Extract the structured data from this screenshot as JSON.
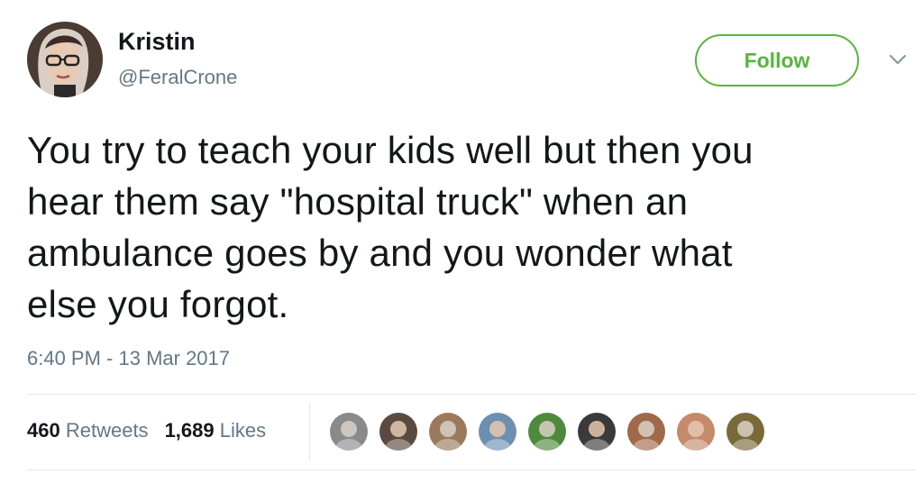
{
  "author": {
    "display_name": "Kristin",
    "handle": "@FeralCrone",
    "avatar_icon": "profile-photo-woman-glasses"
  },
  "follow_button": {
    "label": "Follow",
    "color": "#57b53c"
  },
  "menu_icon": "chevron-down-icon",
  "tweet": {
    "lines": [
      "You try to teach your kids well but then you",
      "hear them say \"hospital truck\" when an",
      "ambulance goes by and you wonder what",
      "else you forgot."
    ],
    "timestamp": "6:40 PM - 13 Mar 2017"
  },
  "stats": {
    "retweets_count": "460",
    "retweets_label": "Retweets",
    "likes_count": "1,689",
    "likes_label": "Likes"
  },
  "liked_by": [
    {
      "icon": "liker-avatar-1",
      "color": "#8a8a8a"
    },
    {
      "icon": "liker-avatar-2",
      "color": "#5a4a3f"
    },
    {
      "icon": "liker-avatar-3",
      "color": "#9a7a5a"
    },
    {
      "icon": "liker-avatar-4",
      "color": "#6d8fb0"
    },
    {
      "icon": "liker-avatar-5",
      "color": "#4f8a3c"
    },
    {
      "icon": "liker-avatar-6",
      "color": "#3a3a3a"
    },
    {
      "icon": "liker-avatar-7",
      "color": "#a06a4a"
    },
    {
      "icon": "liker-avatar-8",
      "color": "#c48a6a"
    },
    {
      "icon": "liker-avatar-9",
      "color": "#7a6a3a"
    }
  ],
  "colors": {
    "text": "#14171a",
    "secondary": "#657786",
    "divider": "#e1e8ed"
  }
}
